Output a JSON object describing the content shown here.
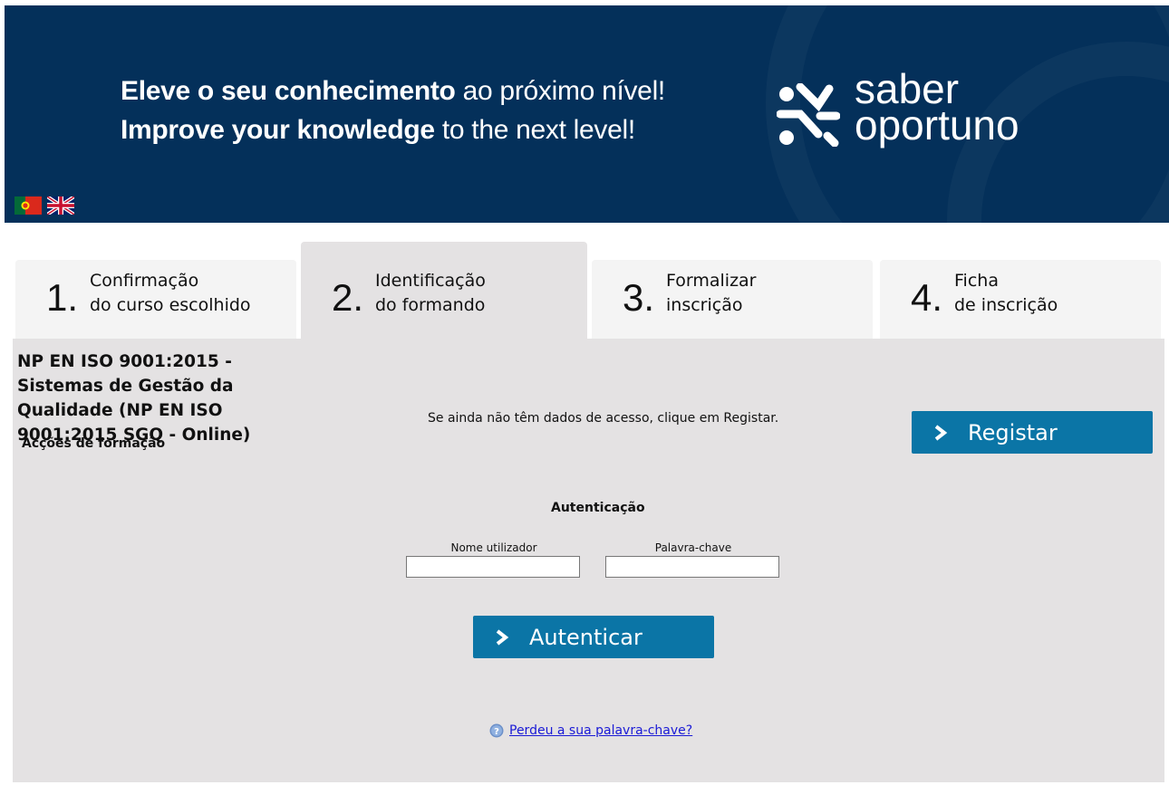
{
  "banner": {
    "tagline_pt_bold": "Eleve o seu conhecimento",
    "tagline_pt_light": " ao próximo nível!",
    "tagline_en_bold": "Improve your knowledge",
    "tagline_en_light": " to the next level!",
    "logo_line1": "saber",
    "logo_line2": "oportuno",
    "bg_color": "#04305a"
  },
  "languages": [
    {
      "name": "Português",
      "icon": "portugal-flag-icon"
    },
    {
      "name": "English",
      "icon": "uk-flag-icon"
    }
  ],
  "steps": [
    {
      "num": "1.",
      "line1": "Confirmação",
      "line2": "do curso escolhido",
      "active": false
    },
    {
      "num": "2.",
      "line1": "Identificação",
      "line2": "do formando",
      "active": true
    },
    {
      "num": "3.",
      "line1": "Formalizar",
      "line2": "inscrição",
      "active": false
    },
    {
      "num": "4.",
      "line1": "Ficha",
      "line2": "de inscrição",
      "active": false
    }
  ],
  "course": {
    "title": "NP EN ISO 9001:2015 - Sistemas de Gestão da Qualidade (NP EN ISO 9001:2015 SGQ - Online)",
    "subtitle": "Acções de formação"
  },
  "register": {
    "message": "Se ainda não têm dados de acesso, clique em Registar.",
    "button_label": "Registar"
  },
  "auth": {
    "title": "Autenticação",
    "username_label": "Nome utilizador",
    "username_value": "",
    "password_label": "Palavra-chave",
    "password_value": "",
    "button_label": "Autenticar",
    "forgot_link": "Perdeu a sua palavra-chave?"
  },
  "colors": {
    "accent_button": "#0b75a6",
    "content_bg": "#e4e2e3",
    "tab_bg": "#f4f4f4",
    "link": "#1a1ad6"
  }
}
